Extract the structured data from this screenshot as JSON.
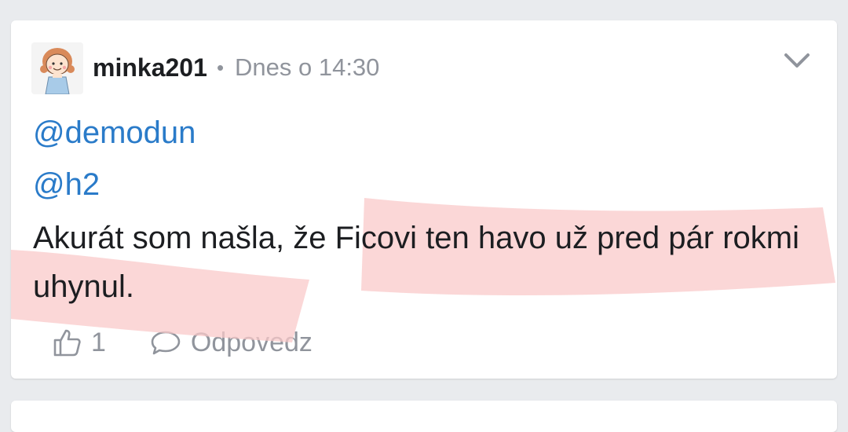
{
  "post": {
    "author": "minka201",
    "separator": "•",
    "timestamp": "Dnes o 14:30",
    "mentions": [
      "@demodun",
      "@h2"
    ],
    "text": "Akurát som našla, že Ficovi ten havo už pred pár rokmi uhynul.",
    "likes": "1",
    "reply_label": "Odpovedz"
  },
  "icons": {
    "avatar": "cartoon-girl-avatar",
    "menu": "chevron-down-icon",
    "like": "thumbs-up-icon",
    "reply": "speech-bubble-icon"
  },
  "colors": {
    "mention": "#2a7bc9",
    "highlight": "#f9c9c9",
    "meta": "#90949c",
    "text": "#1c1e21"
  }
}
